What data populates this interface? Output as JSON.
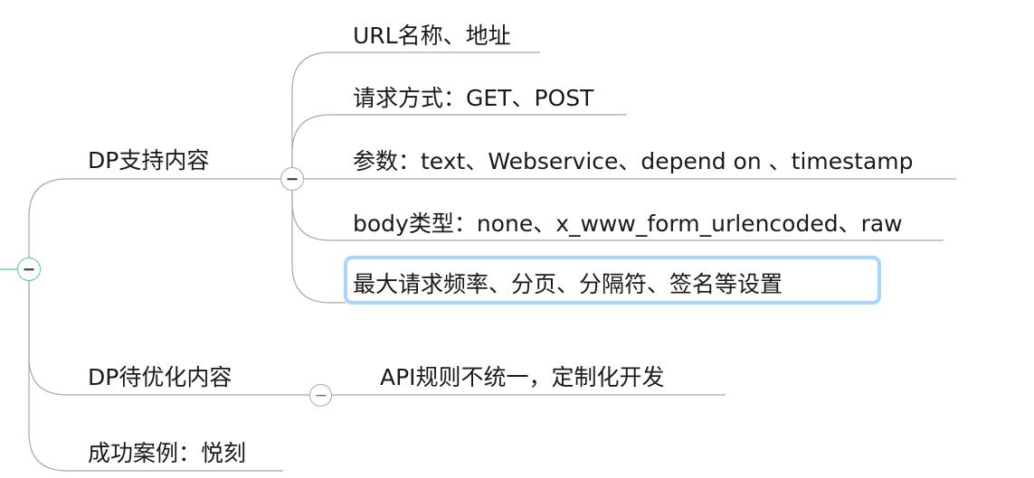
{
  "root_toggle": {
    "icon": "collapse-minus-icon",
    "color": "#5cc98a"
  },
  "branches": [
    {
      "label": "DP支持内容",
      "children": [
        {
          "label": "URL名称、地址"
        },
        {
          "label": "请求方式：GET、POST"
        },
        {
          "label": "参数：text、Webservice、depend on 、timestamp"
        },
        {
          "label": "body类型：none、x_www_form_urlencoded、raw"
        },
        {
          "label": "最大请求频率、分页、分隔符、签名等设置",
          "selected": true
        }
      ]
    },
    {
      "label": "DP待优化内容",
      "children": [
        {
          "label": "API规则不统一，定制化开发"
        }
      ]
    },
    {
      "label": "成功案例：悦刻",
      "children": []
    }
  ],
  "colors": {
    "line": "#a8a8a8",
    "selection": "#a9d4fb",
    "text": "#1a1a1a"
  }
}
